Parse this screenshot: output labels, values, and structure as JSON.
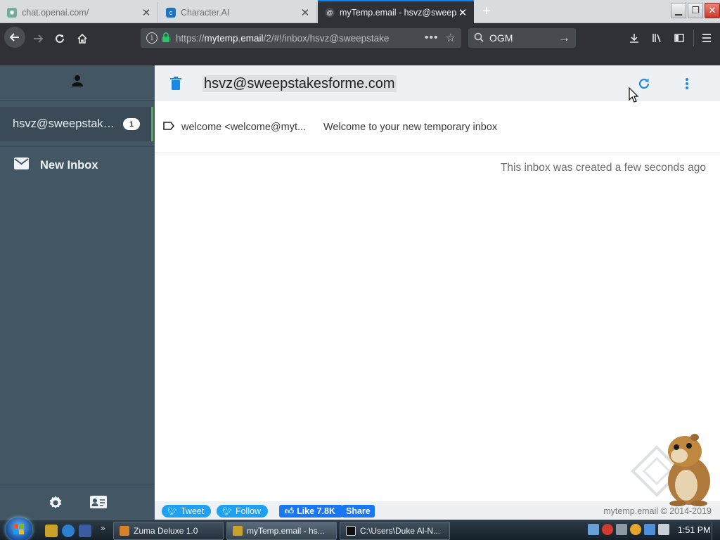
{
  "browser": {
    "tabs": [
      {
        "title": "chat.openai.com/",
        "active": false
      },
      {
        "title": "Character.AI",
        "active": false
      },
      {
        "title": "myTemp.email - hsvz@sweeps",
        "active": true
      }
    ],
    "url_prefix": "https://",
    "url_domain": "mytemp.email",
    "url_path": "/2/#!/inbox/hsvz@sweepstake",
    "search_value": "OGM"
  },
  "sidebar": {
    "inbox_address": "hsvz@sweepstakes...",
    "inbox_badge": "1",
    "new_inbox_label": "New Inbox"
  },
  "main": {
    "address_title": "hsvz@sweepstakesforme.com",
    "messages": [
      {
        "from": "welcome <welcome@myt...",
        "subject": "Welcome to your new temporary inbox"
      }
    ],
    "created_notice": "This inbox was created a few seconds ago"
  },
  "footer": {
    "tweet_label": "Tweet",
    "follow_label": "Follow",
    "like_label": "Like 7.8K",
    "share_label": "Share",
    "copyright": "mytemp.email © 2014-2019"
  },
  "taskbar": {
    "tasks": [
      {
        "label": "Zuma Deluxe 1.0"
      },
      {
        "label": "myTemp.email - hs..."
      },
      {
        "label": "C:\\Users\\Duke Al-N..."
      }
    ],
    "clock": "1:51 PM"
  },
  "colors": {
    "sidebar_bg": "#435663",
    "accent_green": "#4caf50",
    "icon_blue": "#1e88e5",
    "toolbar_bg": "#2f3136"
  }
}
